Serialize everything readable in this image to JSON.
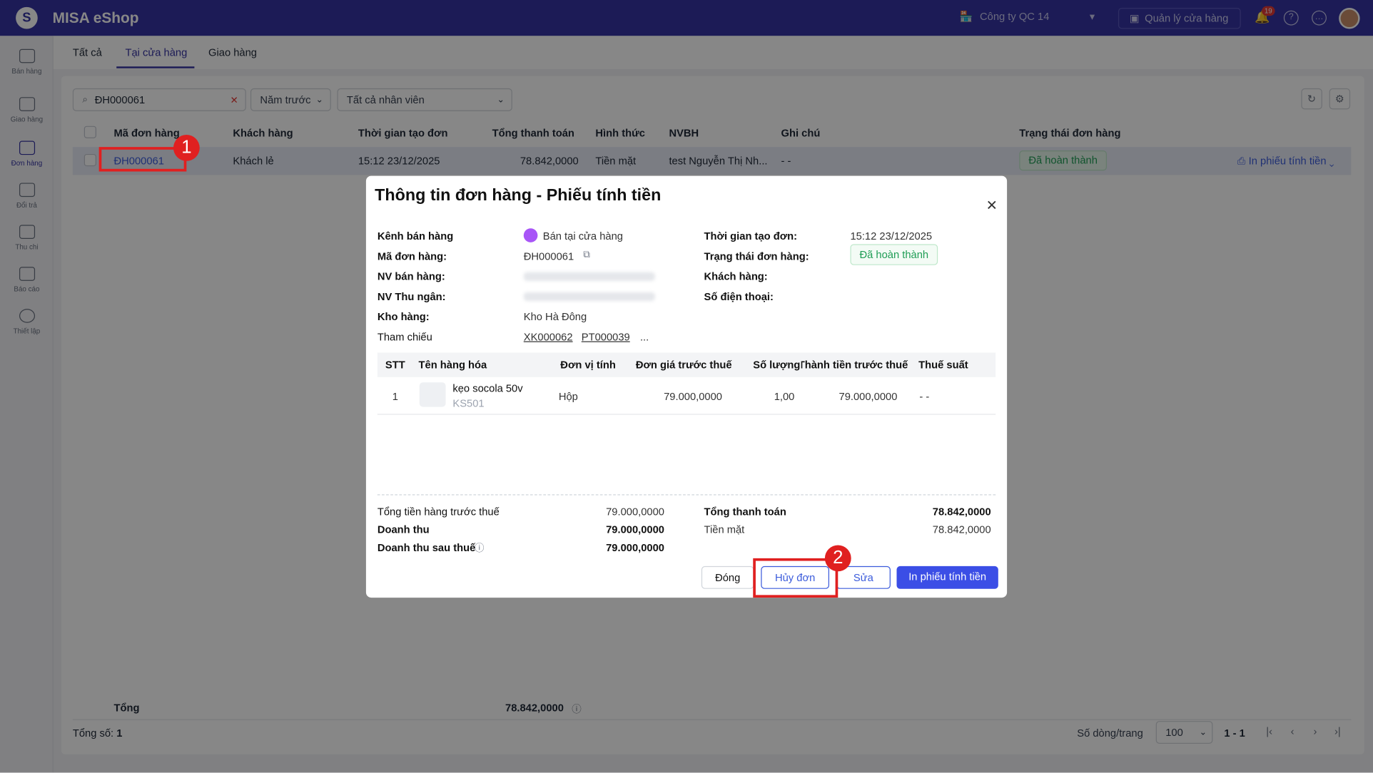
{
  "app": {
    "name": "MISA eShop",
    "logo_letter": "S"
  },
  "topbar": {
    "company": "Công ty QC 14",
    "manage_button": "Quản lý cửa hàng",
    "notification_count": "19"
  },
  "sidebar": {
    "items": [
      {
        "label": "Bán hàng",
        "icon": "shopping-bag-icon"
      },
      {
        "label": "Giao hàng",
        "icon": "truck-icon"
      },
      {
        "label": "Đơn hàng",
        "icon": "clipboard-icon",
        "active": true
      },
      {
        "label": "Đổi trả",
        "icon": "return-box-icon"
      },
      {
        "label": "Thu chi",
        "icon": "cash-icon"
      },
      {
        "label": "Báo cáo",
        "icon": "bar-chart-icon"
      },
      {
        "label": "Thiết lập",
        "icon": "gear-icon"
      }
    ]
  },
  "tabs": [
    "Tất cả",
    "Tại cửa hàng",
    "Giao hàng"
  ],
  "filters": {
    "search_value": "ĐH000061",
    "period": "Năm trước",
    "staff": "Tất cả nhân viên"
  },
  "table": {
    "columns": [
      "Mã đơn hàng",
      "Khách hàng",
      "Thời gian tạo đơn",
      "Tổng thanh toán",
      "Hình thức",
      "NVBH",
      "Ghi chú",
      "Trạng thái đơn hàng"
    ],
    "rows": [
      {
        "code": "ĐH000061",
        "customer": "Khách lẻ",
        "time": "15:12 23/12/2025",
        "total": "78.842,0000",
        "method": "Tiền mặt",
        "staff": "test Nguyễn Thị Nh...",
        "note": "- -",
        "status": "Đã hoàn thành",
        "action": "In phiếu tính tiền"
      }
    ],
    "footer_label": "Tổng",
    "footer_total": "78.842,0000"
  },
  "pagination": {
    "total_label": "Tổng số:",
    "total_count": "1",
    "rows_per_page_label": "Số dòng/trang",
    "rows_per_page": "100",
    "range": "1 - 1"
  },
  "modal": {
    "title": "Thông tin đơn hàng - Phiếu tính tiền",
    "info_left": [
      {
        "label": "Kênh bán hàng",
        "value": "Bán tại cửa hàng"
      },
      {
        "label": "Mã đơn hàng:",
        "value": "ĐH000061"
      },
      {
        "label": "NV bán hàng:",
        "value": ""
      },
      {
        "label": "NV Thu ngân:",
        "value": ""
      },
      {
        "label": "Kho hàng:",
        "value": "Kho Hà Đông"
      },
      {
        "label": "Tham chiếu",
        "value": ""
      }
    ],
    "references": [
      "XK000062",
      "PT000039",
      "..."
    ],
    "info_right": [
      {
        "label": "Thời gian tạo đơn:",
        "value": "15:12 23/12/2025"
      },
      {
        "label": "Trạng thái đơn hàng:",
        "value": "Đã hoàn thành"
      },
      {
        "label": "Khách hàng:",
        "value": ""
      },
      {
        "label": "Số điện thoại:",
        "value": ""
      }
    ],
    "items_columns": [
      "STT",
      "Tên hàng hóa",
      "Đơn vị tính",
      "Đơn giá trước thuế",
      "Số lượng",
      "Thành tiền trước thuế",
      "Thuế suất"
    ],
    "items": [
      {
        "stt": "1",
        "name": "kẹo socola 50v",
        "sku": "KS501",
        "unit": "Hộp",
        "price": "79.000,0000",
        "qty": "1,00",
        "amount": "79.000,0000",
        "tax": "- -"
      }
    ],
    "summary_left": [
      {
        "label": "Tổng tiền hàng trước thuế",
        "value": "79.000,0000"
      },
      {
        "label": "Doanh thu",
        "value": "79.000,0000"
      },
      {
        "label": "Doanh thu sau thuế",
        "value": "79.000,0000"
      }
    ],
    "summary_right": [
      {
        "label": "Tổng thanh toán",
        "value": "78.842,0000"
      },
      {
        "label": "Tiền mặt",
        "value": "78.842,0000"
      }
    ],
    "buttons": {
      "close": "Đóng",
      "cancel_order": "Hủy đơn",
      "edit": "Sửa",
      "print": "In phiếu tính tiền"
    }
  },
  "annotations": [
    "1",
    "2"
  ],
  "colors": {
    "primary": "#3634a3",
    "accent_blue": "#3b5bdb",
    "success": "#1f9d55",
    "highlight_red": "#e02020"
  }
}
